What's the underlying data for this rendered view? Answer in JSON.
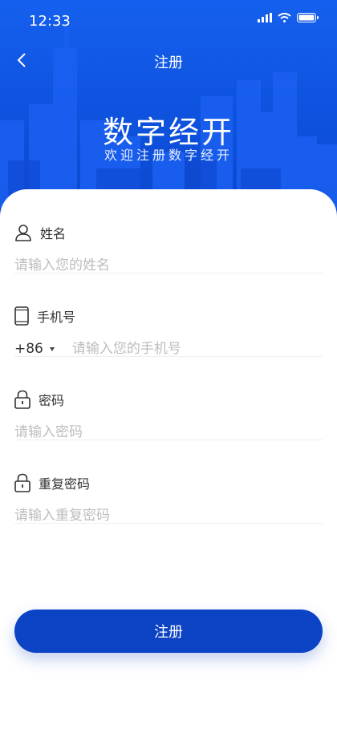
{
  "status_bar": {
    "time": "12:33"
  },
  "navbar": {
    "title": "注册"
  },
  "brand": {
    "title": "数字经开",
    "subtitle": "欢迎注册数字经开"
  },
  "form": {
    "name": {
      "label": "姓名",
      "placeholder": "请输入您的姓名"
    },
    "phone": {
      "label": "手机号",
      "country_code": "+86",
      "placeholder": "请输入您的手机号"
    },
    "password": {
      "label": "密码",
      "placeholder": "请输入密码"
    },
    "confirm_password": {
      "label": "重复密码",
      "placeholder": "请输入重复密码"
    }
  },
  "submit": {
    "label": "注册"
  },
  "colors": {
    "primary": "#0b43c4",
    "hero": "#1560ee"
  }
}
